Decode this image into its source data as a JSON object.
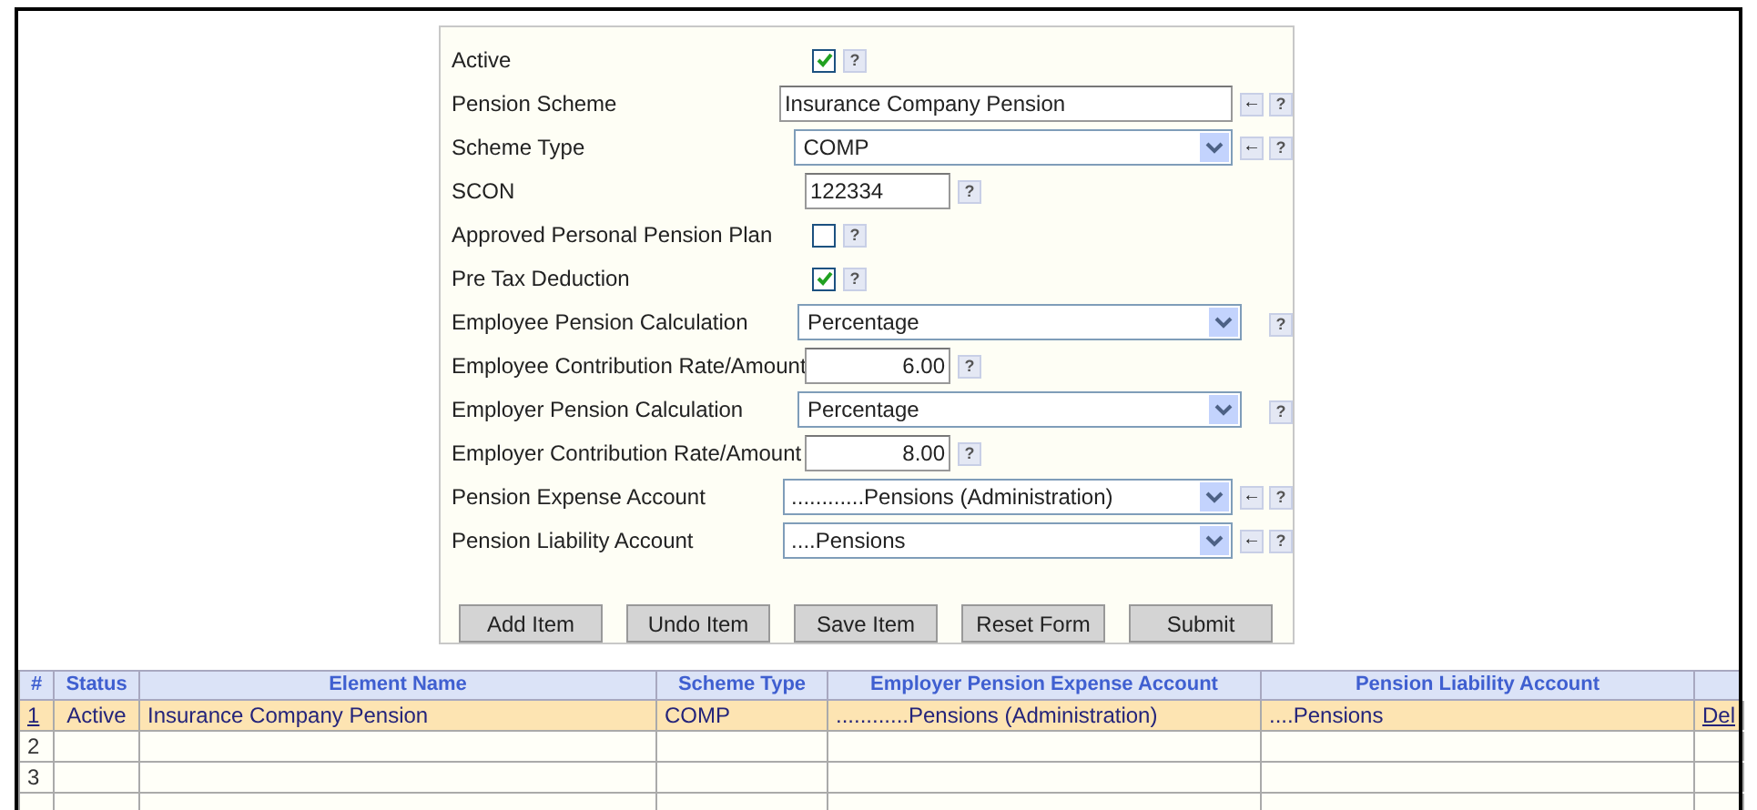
{
  "form": {
    "fields": [
      {
        "label": "Active",
        "kind": "checkbox",
        "checked": true,
        "arrow": false
      },
      {
        "label": "Pension Scheme",
        "kind": "text",
        "value": "Insurance Company Pension",
        "arrow": true
      },
      {
        "label": "Scheme Type",
        "kind": "select",
        "value": "COMP",
        "arrow": true
      },
      {
        "label": "SCON",
        "kind": "code",
        "value": "122334",
        "arrow": false
      },
      {
        "label": "Approved Personal Pension Plan",
        "kind": "checkbox",
        "checked": false,
        "arrow": false
      },
      {
        "label": "Pre Tax Deduction",
        "kind": "checkbox",
        "checked": true,
        "arrow": false
      },
      {
        "label": "Employee Pension Calculation",
        "kind": "select",
        "value": "Percentage",
        "arrow": false
      },
      {
        "label": "Employee Contribution Rate/Amount",
        "kind": "number",
        "value": "6.00",
        "arrow": false
      },
      {
        "label": "Employer Pension Calculation",
        "kind": "select",
        "value": "Percentage",
        "arrow": false
      },
      {
        "label": "Employer Contribution Rate/Amount",
        "kind": "number",
        "value": "8.00",
        "arrow": false
      },
      {
        "label": "Pension Expense Account",
        "kind": "account",
        "value": "............Pensions (Administration)",
        "arrow": true
      },
      {
        "label": "Pension Liability Account",
        "kind": "account",
        "value": "....Pensions",
        "arrow": true
      }
    ],
    "help": "?",
    "back_arrow": "←",
    "buttons": [
      "Add Item",
      "Undo Item",
      "Save Item",
      "Reset Form",
      "Submit"
    ]
  },
  "table": {
    "columns": [
      "#",
      "Status",
      "Element Name",
      "Scheme Type",
      "Employer Pension Expense Account",
      "Pension Liability Account"
    ],
    "rows": [
      {
        "cells": [
          "1",
          "Active",
          "Insurance Company Pension",
          "COMP",
          "............Pensions (Administration)",
          "....Pensions"
        ],
        "action": "Del",
        "selected": true
      },
      {
        "cells": [
          "2"
        ],
        "selected": false
      },
      {
        "cells": [
          "3"
        ],
        "selected": false
      },
      {
        "cells": [],
        "selected": false
      }
    ]
  }
}
